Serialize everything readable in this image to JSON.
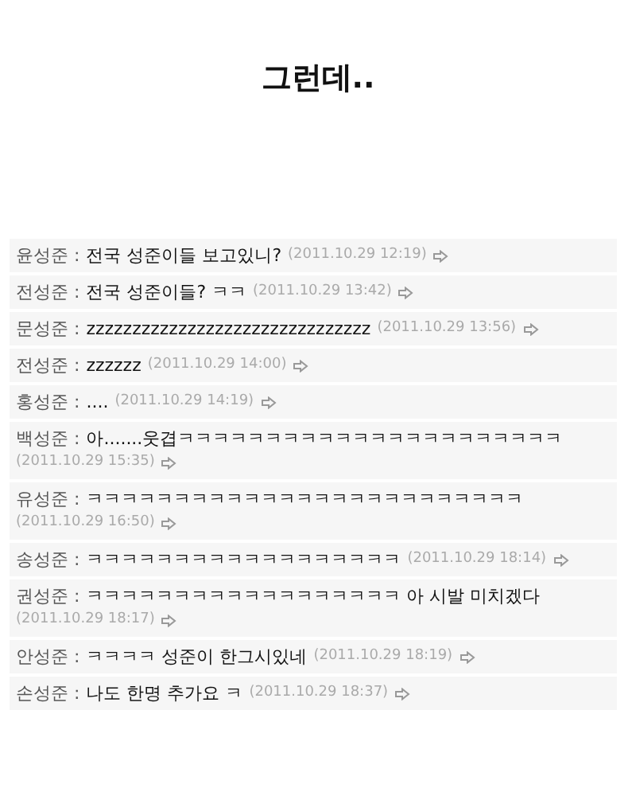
{
  "title": "그런데..",
  "comments": [
    {
      "author": "윤성준 :",
      "text": "전국 성준이들 보고있니?",
      "time": "(2011.10.29 12:19)"
    },
    {
      "author": "전성준 :",
      "text": "전국 성준이들? ㅋㅋ",
      "time": "(2011.10.29 13:42)"
    },
    {
      "author": "문성준 :",
      "text": "zzzzzzzzzzzzzzzzzzzzzzzzzzzzzzz",
      "time": "(2011.10.29 13:56)"
    },
    {
      "author": "전성준 :",
      "text": "zzzzzz",
      "time": "(2011.10.29 14:00)"
    },
    {
      "author": "홍성준 :",
      "text": "....",
      "time": "(2011.10.29 14:19)"
    },
    {
      "author": "백성준 :",
      "text": "아.......웃겹ㅋㅋㅋㅋㅋㅋㅋㅋㅋㅋㅋㅋㅋㅋㅋㅋㅋㅋㅋㅋㅋㅋ",
      "time": "(2011.10.29 15:35)"
    },
    {
      "author": "유성준 :",
      "text": "ㅋㅋㅋㅋㅋㅋㅋㅋㅋㅋㅋㅋㅋㅋㅋㅋㅋㅋㅋㅋㅋㅋㅋㅋㅋ",
      "time": "(2011.10.29 16:50)"
    },
    {
      "author": "송성준 :",
      "text": "ㅋㅋㅋㅋㅋㅋㅋㅋㅋㅋㅋㅋㅋㅋㅋㅋㅋㅋ",
      "time": "(2011.10.29 18:14)"
    },
    {
      "author": "권성준 :",
      "text": "ㅋㅋㅋㅋㅋㅋㅋㅋㅋㅋㅋㅋㅋㅋㅋㅋㅋㅋ 아 시발 미치겠다",
      "time": "(2011.10.29 18:17)"
    },
    {
      "author": "안성준 :",
      "text": "ㅋㅋㅋㅋ 성준이 한그시있네",
      "time": "(2011.10.29 18:19)"
    },
    {
      "author": "손성준 :",
      "text": "나도 한명 추가요 ㅋ",
      "time": "(2011.10.29 18:37)"
    }
  ]
}
